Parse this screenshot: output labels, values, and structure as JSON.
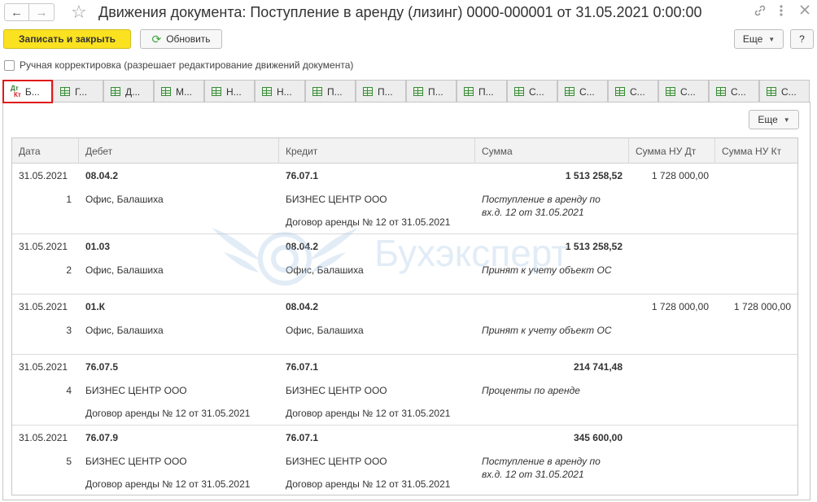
{
  "window": {
    "title": "Движения документа: Поступление в аренду (лизинг) 0000-000001 от 31.05.2021 0:00:00",
    "nav_back_icon": "arrow-left-icon",
    "nav_forward_icon": "arrow-right-icon",
    "favorite_icon": "star-icon",
    "link_icon": "link-icon",
    "menu_icon": "more-vertical-icon",
    "close_icon": "close-icon"
  },
  "toolbar": {
    "save_close_label": "Записать и закрыть",
    "refresh_label": "Обновить",
    "more_label": "Еще",
    "help_label": "?"
  },
  "manual": {
    "label": "Ручная корректировка (разрешает редактирование движений документа)",
    "checked": false
  },
  "tabs": [
    {
      "label": "Б...",
      "icon": "dt-kt-icon",
      "active": true
    },
    {
      "label": "Г...",
      "icon": "register-icon"
    },
    {
      "label": "Д...",
      "icon": "register-icon"
    },
    {
      "label": "М...",
      "icon": "register-icon"
    },
    {
      "label": "Н...",
      "icon": "register-icon"
    },
    {
      "label": "Н...",
      "icon": "register-icon"
    },
    {
      "label": "П...",
      "icon": "register-icon"
    },
    {
      "label": "П...",
      "icon": "register-icon"
    },
    {
      "label": "П...",
      "icon": "register-icon"
    },
    {
      "label": "П...",
      "icon": "register-icon"
    },
    {
      "label": "С...",
      "icon": "register-icon"
    },
    {
      "label": "С...",
      "icon": "register-icon"
    },
    {
      "label": "С...",
      "icon": "register-icon"
    },
    {
      "label": "С...",
      "icon": "register-icon"
    },
    {
      "label": "С...",
      "icon": "register-icon"
    },
    {
      "label": "С...",
      "icon": "register-icon"
    }
  ],
  "panel": {
    "more_label": "Еще"
  },
  "watermark": {
    "text": "Бухэксперт"
  },
  "table": {
    "columns": [
      "Дата",
      "Дебет",
      "Кредит",
      "Сумма",
      "Сумма НУ Дт",
      "Сумма НУ Кт"
    ],
    "rows": [
      {
        "date": "31.05.2021",
        "num": "1",
        "debit": "08.04.2",
        "debit_sub1": "Офис, Балашиха",
        "debit_sub2": "",
        "credit": "76.07.1",
        "credit_sub1": "БИЗНЕС ЦЕНТР ООО",
        "credit_sub2": "Договор аренды № 12 от 31.05.2021",
        "sum": "1 513 258,52",
        "content": "Поступление в аренду по вх.д. 12 от 31.05.2021",
        "nu_dt": "1 728 000,00",
        "nu_kt": ""
      },
      {
        "date": "31.05.2021",
        "num": "2",
        "debit": "01.03",
        "debit_sub1": "Офис, Балашиха",
        "debit_sub2": "",
        "credit": "08.04.2",
        "credit_sub1": "Офис, Балашиха",
        "credit_sub2": "",
        "sum": "1 513 258,52",
        "content": "Принят к учету объект ОС",
        "nu_dt": "",
        "nu_kt": ""
      },
      {
        "date": "31.05.2021",
        "num": "3",
        "debit": "01.К",
        "debit_sub1": "Офис, Балашиха",
        "debit_sub2": "",
        "credit": "08.04.2",
        "credit_sub1": "Офис, Балашиха",
        "credit_sub2": "",
        "sum": "",
        "content": "Принят к учету объект ОС",
        "nu_dt": "1 728 000,00",
        "nu_kt": "1 728 000,00"
      },
      {
        "date": "31.05.2021",
        "num": "4",
        "debit": "76.07.5",
        "debit_sub1": "БИЗНЕС ЦЕНТР ООО",
        "debit_sub2": "Договор аренды № 12 от 31.05.2021",
        "credit": "76.07.1",
        "credit_sub1": "БИЗНЕС ЦЕНТР ООО",
        "credit_sub2": "Договор аренды № 12 от 31.05.2021",
        "sum": "214 741,48",
        "content": "Проценты по аренде",
        "nu_dt": "",
        "nu_kt": ""
      },
      {
        "date": "31.05.2021",
        "num": "5",
        "debit": "76.07.9",
        "debit_sub1": "БИЗНЕС ЦЕНТР ООО",
        "debit_sub2": "Договор аренды № 12 от 31.05.2021",
        "credit": "76.07.1",
        "credit_sub1": "БИЗНЕС ЦЕНТР ООО",
        "credit_sub2": "Договор аренды № 12 от 31.05.2021",
        "sum": "345 600,00",
        "content": "Поступление в аренду по вх.д. 12 от 31.05.2021",
        "nu_dt": "",
        "nu_kt": ""
      }
    ]
  }
}
